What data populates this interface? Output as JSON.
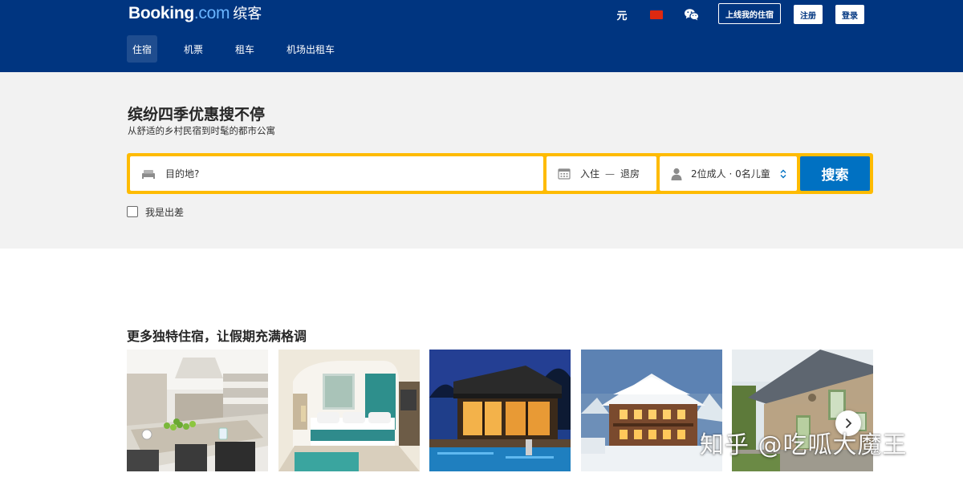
{
  "header": {
    "logo_booking": "Booking",
    "logo_com": ".com",
    "logo_cn": "缤客",
    "currency": "元",
    "language_flag_icon": "china-flag-icon",
    "wechat_icon": "wechat-icon",
    "list_property": "上线我的住宿",
    "register": "注册",
    "login": "登录",
    "colors": {
      "background": "#003580",
      "accent_text": "#6ab4ff"
    }
  },
  "nav": {
    "items": [
      {
        "label": "住宿",
        "active": true
      },
      {
        "label": "机票",
        "active": false
      },
      {
        "label": "租车",
        "active": false
      },
      {
        "label": "机场出租车",
        "active": false
      }
    ]
  },
  "hero": {
    "title": "缤纷四季优惠搜不停",
    "subtitle": "从舒适的乡村民宿到时髦的都市公寓"
  },
  "search": {
    "destination_placeholder": "目的地?",
    "checkin": "入住",
    "dash": "—",
    "checkout": "退房",
    "guests": "2位成人 · 0名儿童",
    "button": "搜索",
    "business_trip": "我是出差",
    "colors": {
      "frame": "#febb02",
      "button": "#0071c2"
    }
  },
  "unique_stays": {
    "title": "更多独特住宿，让假期充满格调",
    "cards": [
      {
        "image": "modern-kitchen-photo"
      },
      {
        "image": "hotel-bedroom-photo"
      },
      {
        "image": "villa-pool-night-photo"
      },
      {
        "image": "snowy-chalet-photo"
      },
      {
        "image": "stone-cottage-photo"
      }
    ],
    "next_icon": "chevron-right-icon"
  },
  "watermark": "知乎 @吃呱大魔王"
}
